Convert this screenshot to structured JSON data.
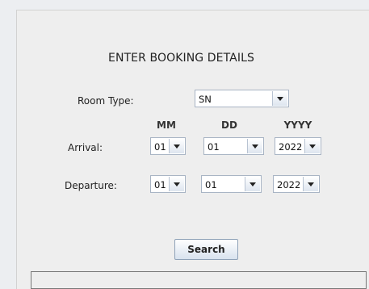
{
  "form": {
    "title": "ENTER BOOKING DETAILS",
    "room_type_label": "Room Type:",
    "room_type_value": "SN",
    "col_mm": "MM",
    "col_dd": "DD",
    "col_yyyy": "YYYY",
    "arrival_label": "Arrival:",
    "departure_label": "Departure:",
    "arrival": {
      "mm": "01",
      "dd": "01",
      "yyyy": "2022"
    },
    "departure": {
      "mm": "01",
      "dd": "01",
      "yyyy": "2022"
    },
    "search_label": "Search",
    "status_text": ""
  },
  "colors": {
    "background": "#eeeeee",
    "combo_border": "#a8b4c4",
    "button_border": "#8fa2b8"
  }
}
